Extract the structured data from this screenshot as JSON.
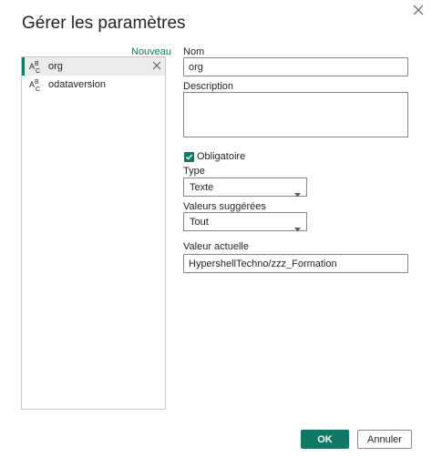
{
  "dialog": {
    "title": "Gérer les paramètres",
    "new_label": "Nouveau"
  },
  "parameters": [
    {
      "name": "org",
      "icon": "abc-text-type-icon",
      "selected": true
    },
    {
      "name": "odataversion",
      "icon": "abc-text-type-icon",
      "selected": false
    }
  ],
  "form": {
    "name_label": "Nom",
    "name_value": "org",
    "description_label": "Description",
    "description_value": "",
    "required_label": "Obligatoire",
    "required_checked": true,
    "type_label": "Type",
    "type_value": "Texte",
    "suggested_label": "Valeurs suggérées",
    "suggested_value": "Tout",
    "current_label": "Valeur actuelle",
    "current_value": "HypershellTechno/zzz_Formation"
  },
  "buttons": {
    "ok_label": "OK",
    "cancel_label": "Annuler"
  },
  "colors": {
    "accent": "#117865",
    "selected_bg": "#edebe9",
    "border": "#8a8886"
  }
}
